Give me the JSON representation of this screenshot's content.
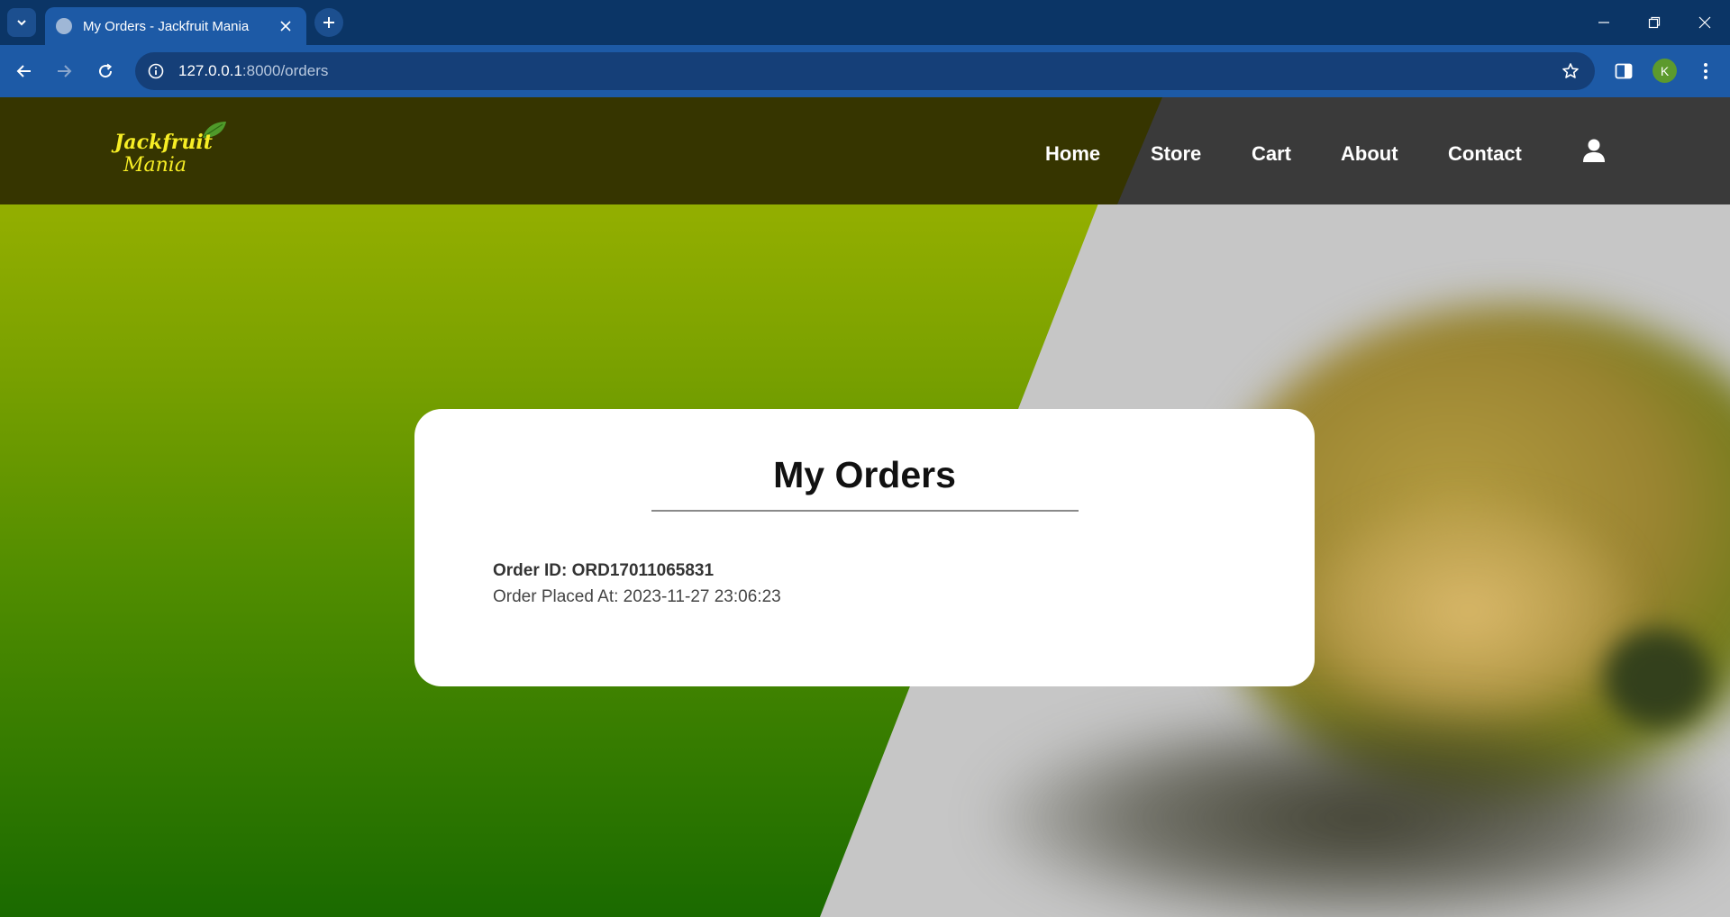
{
  "browser": {
    "tab_title": "My Orders - Jackfruit Mania",
    "url_host": "127.0.0.1",
    "url_path": ":8000/orders",
    "profile_initial": "K"
  },
  "site": {
    "logo_line1": "Jackfruit",
    "logo_line2": "Mania",
    "nav": {
      "home": "Home",
      "store": "Store",
      "cart": "Cart",
      "about": "About",
      "contact": "Contact"
    }
  },
  "orders": {
    "title": "My Orders",
    "items": [
      {
        "order_id": "Order ID: ORD17011065831",
        "placed_at": "Order Placed At: 2023-11-27 23:06:23"
      }
    ]
  },
  "colors": {
    "logo_yellow": "#f7ee25",
    "header_dark": "#3a3a3a",
    "chrome_blue": "#1d5aa6"
  }
}
